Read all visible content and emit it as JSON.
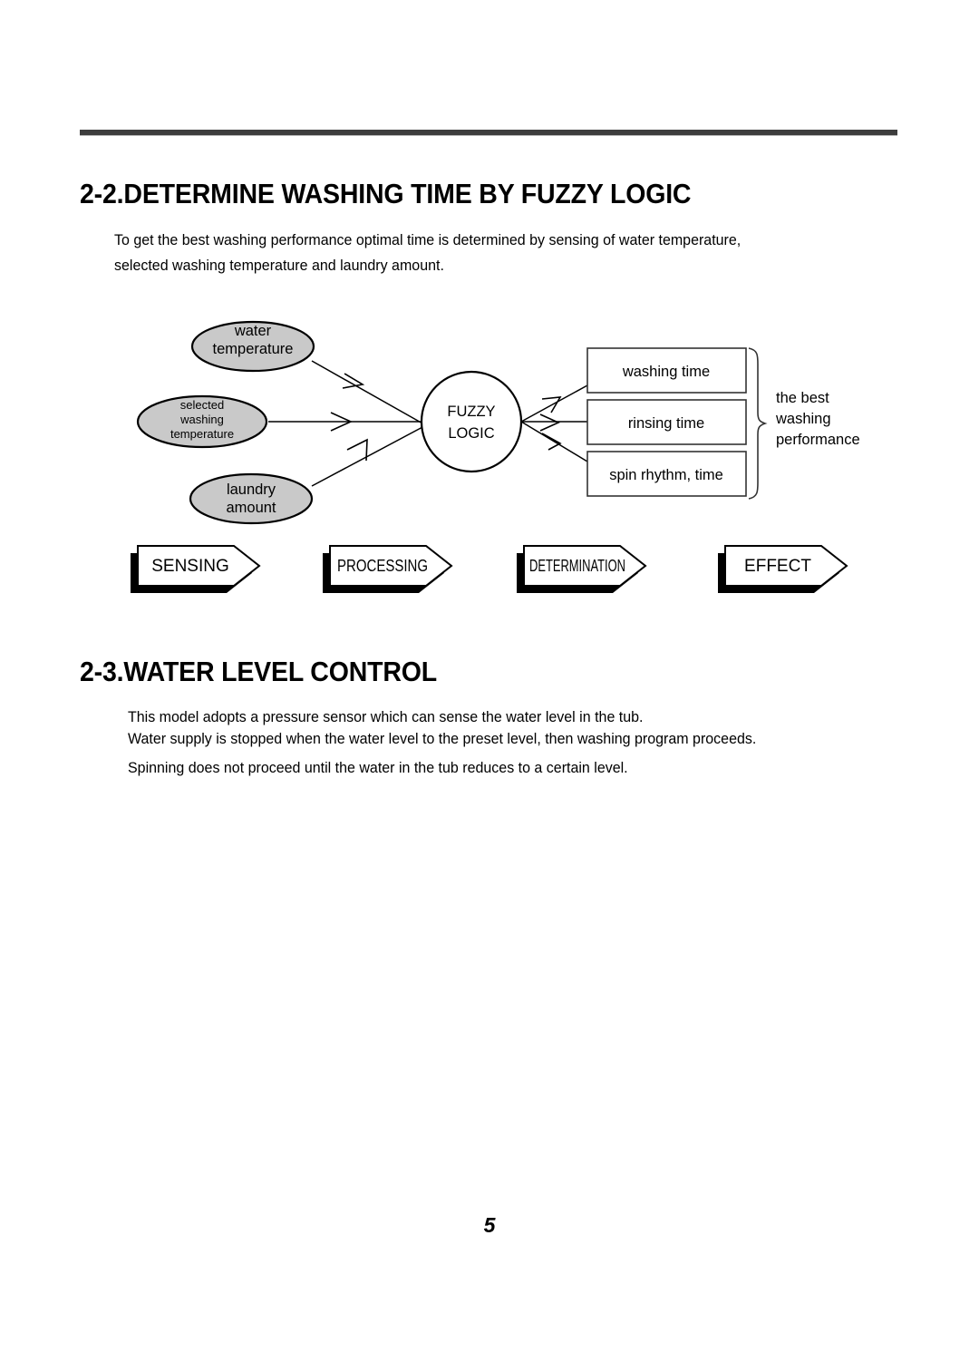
{
  "page": {
    "number": "5"
  },
  "sections": [
    {
      "heading": "2-2.DETERMINE WASHING TIME BY FUZZY LOGIC",
      "paragraph_lines": [
        "To get the best washing performance optimal time is determined by sensing of water temperature,",
        "selected washing temperature and laundry amount."
      ]
    },
    {
      "heading": "2-3.WATER LEVEL CONTROL",
      "paragraph_lines": [
        "This model adopts a pressure sensor which can sense the water level in the tub.",
        " Water supply is stopped when the water level to the preset level, then washing program proceeds.",
        "Spinning does not proceed until the water in the tub reduces to a certain level."
      ]
    }
  ],
  "diagram": {
    "inputs": [
      {
        "lines": [
          "water",
          "temperature"
        ]
      },
      {
        "lines": [
          "selected",
          "washing",
          "temperature"
        ]
      },
      {
        "lines": [
          "laundry",
          "amount"
        ]
      }
    ],
    "processor": {
      "lines": [
        "FUZZY",
        "LOGIC"
      ]
    },
    "outputs": [
      {
        "label": "washing time"
      },
      {
        "label": "rinsing time"
      },
      {
        "label": "spin rhythm, time"
      }
    ],
    "effect": {
      "lines": [
        "the best",
        "washing",
        "performance"
      ]
    },
    "stages": [
      {
        "label": "SENSING"
      },
      {
        "label": "PROCESSING"
      },
      {
        "label": "DETERMINATION"
      },
      {
        "label": "EFFECT"
      }
    ],
    "colors": {
      "input_fill": "#c9c9c9",
      "outline": "#000000",
      "box_outline": "#333333",
      "rule": "#3d3d3d"
    }
  }
}
